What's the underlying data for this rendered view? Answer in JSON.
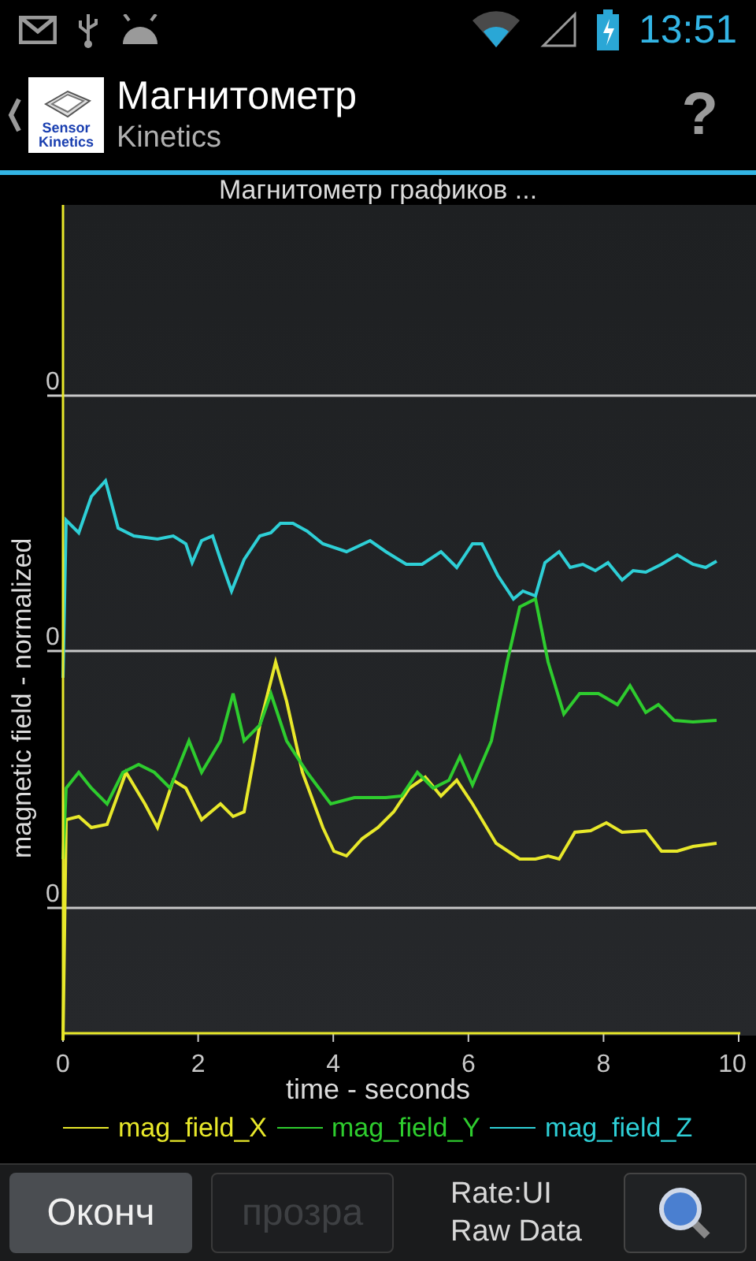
{
  "status_bar": {
    "time": "13:51"
  },
  "action_bar": {
    "title": "Магнитометр",
    "subtitle": "Kinetics",
    "logo_text": [
      "Sensor",
      "Kinetics"
    ],
    "help": "?"
  },
  "chart": {
    "title": "Магнитометр графиков  ...",
    "xlabel": "time - seconds",
    "ylabel": "magnetic field - normalized",
    "xticks": [
      "0",
      "2",
      "4",
      "6",
      "8",
      "10"
    ],
    "yticks": [
      "0",
      "0",
      "0"
    ],
    "series": [
      {
        "name": "mag_field_X",
        "color": "#e8e82a"
      },
      {
        "name": "mag_field_Y",
        "color": "#2ecc2e"
      },
      {
        "name": "mag_field_Z",
        "color": "#2ecfd6"
      }
    ]
  },
  "bottom_bar": {
    "buttons": [
      {
        "label": "Оконч",
        "disabled": false
      },
      {
        "label": "прозра",
        "disabled": true
      }
    ],
    "rate_lines": [
      "Rate:UI",
      "Raw Data"
    ]
  }
}
